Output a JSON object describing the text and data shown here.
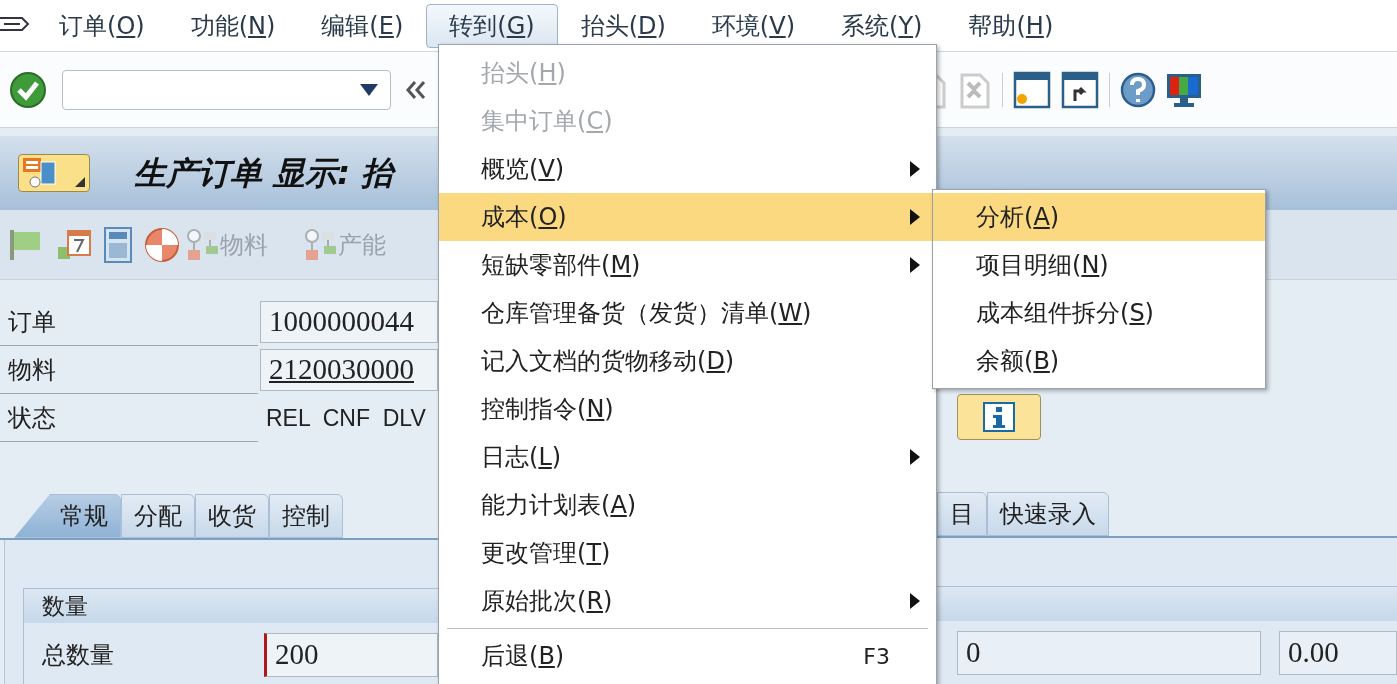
{
  "menu_bar": [
    {
      "before": "订单(",
      "key": "O",
      "after": ")",
      "selected": false
    },
    {
      "before": "功能(",
      "key": "N",
      "after": ")",
      "selected": false
    },
    {
      "before": "编辑(",
      "key": "E",
      "after": ")",
      "selected": false
    },
    {
      "before": "转到(",
      "key": "G",
      "after": ")",
      "selected": true
    },
    {
      "before": "抬头(",
      "key": "D",
      "after": ")",
      "selected": false
    },
    {
      "before": "环境(",
      "key": "V",
      "after": ")",
      "selected": false
    },
    {
      "before": "系统(",
      "key": "Y",
      "after": ")",
      "selected": false
    },
    {
      "before": "帮助(",
      "key": "H",
      "after": ")",
      "selected": false
    }
  ],
  "title": "生产订单 显示: 抬",
  "app_toolbar": [
    {
      "label": "物料",
      "disabled": true
    },
    {
      "label": "产能",
      "disabled": true
    }
  ],
  "fields": [
    {
      "kind": "input",
      "label": "订单",
      "value": "1000000044"
    },
    {
      "kind": "link",
      "label": "物料",
      "value": "2120030000"
    },
    {
      "kind": "text",
      "label": "状态",
      "value": "REL  CNF  DLV"
    }
  ],
  "tabs_left": [
    {
      "label": "常规",
      "selected": true
    },
    {
      "label": "分配",
      "selected": false
    },
    {
      "label": "收货",
      "selected": false
    },
    {
      "label": "控制",
      "selected": false
    }
  ],
  "tabs_right": [
    {
      "label": "目",
      "selected": false
    },
    {
      "label": "快速录入",
      "selected": false
    }
  ],
  "quantity_group": {
    "title": "数量",
    "label": "总数量",
    "value": "200",
    "required": true,
    "right_values": [
      "0",
      "0.00"
    ]
  },
  "goto_menu": [
    {
      "kind": "item",
      "before": "抬头(",
      "key": "H",
      "after": ")",
      "disabled": true,
      "selected": false,
      "submenu": false
    },
    {
      "kind": "item",
      "before": "集中订单(",
      "key": "C",
      "after": ")",
      "disabled": true,
      "selected": false,
      "submenu": false
    },
    {
      "kind": "item",
      "before": "概览(",
      "key": "V",
      "after": ")",
      "disabled": false,
      "selected": false,
      "submenu": true
    },
    {
      "kind": "item",
      "before": "成本(",
      "key": "O",
      "after": ")",
      "disabled": false,
      "selected": true,
      "submenu": true
    },
    {
      "kind": "item",
      "before": "短缺零部件(",
      "key": "M",
      "after": ")",
      "disabled": false,
      "selected": false,
      "submenu": true
    },
    {
      "kind": "item",
      "before": "仓库管理备货（发货）清单(",
      "key": "W",
      "after": ")",
      "disabled": false,
      "selected": false,
      "submenu": false
    },
    {
      "kind": "item",
      "before": "记入文档的货物移动(",
      "key": "D",
      "after": ")",
      "disabled": false,
      "selected": false,
      "submenu": false
    },
    {
      "kind": "item",
      "before": "控制指令(",
      "key": "N",
      "after": ")",
      "disabled": false,
      "selected": false,
      "submenu": false
    },
    {
      "kind": "item",
      "before": "日志(",
      "key": "L",
      "after": ")",
      "disabled": false,
      "selected": false,
      "submenu": true
    },
    {
      "kind": "item",
      "before": "能力计划表(",
      "key": "A",
      "after": ")",
      "disabled": false,
      "selected": false,
      "submenu": false
    },
    {
      "kind": "item",
      "before": "更改管理(",
      "key": "T",
      "after": ")",
      "disabled": false,
      "selected": false,
      "submenu": false
    },
    {
      "kind": "item",
      "before": "原始批次(",
      "key": "R",
      "after": ")",
      "disabled": false,
      "selected": false,
      "submenu": true
    },
    {
      "kind": "separator"
    },
    {
      "kind": "item",
      "before": "后退(",
      "key": "B",
      "after": ")",
      "disabled": false,
      "selected": false,
      "submenu": false,
      "shortcut": "F3"
    }
  ],
  "cost_submenu": [
    {
      "before": "分析(",
      "key": "A",
      "after": ")",
      "selected": true
    },
    {
      "before": "项目明细(",
      "key": "N",
      "after": ")",
      "selected": false
    },
    {
      "before": "成本组件拆分(",
      "key": "S",
      "after": ")",
      "selected": false
    },
    {
      "before": "余额(",
      "key": "B",
      "after": ")",
      "selected": false
    }
  ]
}
